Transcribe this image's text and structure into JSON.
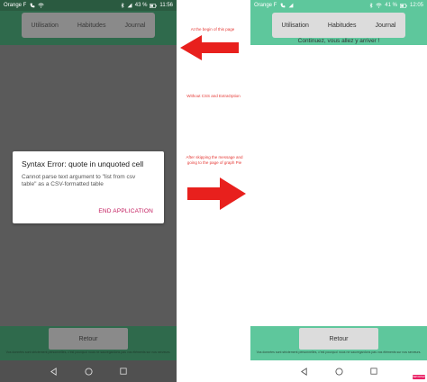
{
  "left_phone": {
    "status": {
      "carrier": "Orange F",
      "battery": "43 %",
      "time": "11:56"
    },
    "tabs": [
      "Utilisation",
      "Habitudes",
      "Journal"
    ],
    "dialog": {
      "title": "Syntax Error: quote in unquoted cell",
      "message": "Cannot parse text argument to \"list from csv table\" as a CSV-formatted table",
      "button": "END APPLICATION"
    },
    "retour": "Retour",
    "footer_text": "Vos données sont strictement personnelles, c'est pourquoi nous ne sauvegardons pas vos éléments sur nos serveurs."
  },
  "annotations": {
    "note_top": "At the begin of this page",
    "note_mid": "Without CSS and ExtraOption",
    "note_bottom": "After skipping the message and going to the page of graph Pie"
  },
  "right_phone": {
    "status": {
      "carrier": "Orange F",
      "battery": "41 %",
      "time": "12:05"
    },
    "tabs": [
      "Utilisation",
      "Habitudes",
      "Journal"
    ],
    "subtitle": "Continuez, vous allez y arriver !",
    "retour": "Retour",
    "footer_text": "Vos données sont strictement personnelles, c'est pourquoi nous ne sauvegardons pas vos éléments sur nos serveurs.",
    "badge": "REPORTER"
  },
  "colors": {
    "arrow_red": "#e8201d",
    "accent_green": "#5ec79c",
    "dark_green": "#2f6a4c",
    "error_pink": "#c2185b"
  },
  "icons": [
    "call-icon",
    "wifi-icon",
    "bluetooth-icon",
    "signal-icon",
    "battery-icon",
    "back-nav-icon",
    "home-nav-icon",
    "recents-nav-icon"
  ]
}
